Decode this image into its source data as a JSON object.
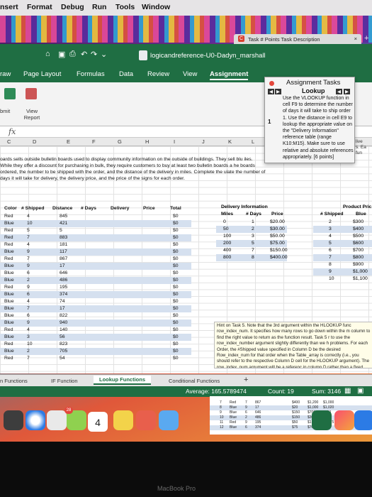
{
  "menubar": {
    "items": [
      "nsert",
      "Format",
      "Debug",
      "Run",
      "Tools",
      "Window"
    ]
  },
  "browser_tab": {
    "title": "Task # Points Task Description",
    "close": "×",
    "new_tab": "+"
  },
  "window": {
    "filename": "logicandreference-U0-Dadyn_marshall"
  },
  "ribbon_tabs": [
    "raw",
    "Page Layout",
    "Formulas",
    "Data",
    "Review",
    "View",
    "Assignment"
  ],
  "ribbon": {
    "submit_label": "bmit",
    "view_report_label": "View Report",
    "fx": "fx"
  },
  "column_headers": [
    "C",
    "D",
    "E",
    "F",
    "G",
    "H",
    "I",
    "J",
    "K",
    "L"
  ],
  "description": "oards sells outside bulletin boards used to display community information on the outside of buildings. They sell blu iles. While they offer a discount for purchasing in bulk, they require customers to buy at least two bulletin boards a he boards ordered, the number to be shipped with the order, and the distance of the delivery in miles. Complete the ulate the number of days it will take for delivery, the delivery price, and the price of the signs for each order.",
  "orders": {
    "headers": [
      "Color",
      "# Shipped",
      "Distance",
      "# Days",
      "Delivery",
      "Price",
      "Total"
    ],
    "rows": [
      [
        "Red",
        "4",
        "845",
        "$0"
      ],
      [
        "Blue",
        "10",
        "421",
        "$0"
      ],
      [
        "Red",
        "5",
        "5",
        "$0"
      ],
      [
        "Red",
        "7",
        "883",
        "$0"
      ],
      [
        "Red",
        "4",
        "181",
        "$0"
      ],
      [
        "Blue",
        "9",
        "117",
        "$0"
      ],
      [
        "Red",
        "7",
        "867",
        "$0"
      ],
      [
        "Blue",
        "9",
        "17",
        "$0"
      ],
      [
        "Blue",
        "6",
        "646",
        "$0"
      ],
      [
        "Blue",
        "2",
        "486",
        "$0"
      ],
      [
        "Red",
        "9",
        "195",
        "$0"
      ],
      [
        "Blue",
        "6",
        "374",
        "$0"
      ],
      [
        "Blue",
        "4",
        "74",
        "$0"
      ],
      [
        "Blue",
        "7",
        "17",
        "$0"
      ],
      [
        "Blue",
        "6",
        "822",
        "$0"
      ],
      [
        "Blue",
        "9",
        "940",
        "$0"
      ],
      [
        "Red",
        "4",
        "140",
        "$0"
      ],
      [
        "Blue",
        "3",
        "56",
        "$0"
      ],
      [
        "Red",
        "10",
        "823",
        "$0"
      ],
      [
        "Blue",
        "2",
        "705",
        "$0"
      ],
      [
        "Red",
        "7",
        "54",
        "$0"
      ]
    ]
  },
  "delivery": {
    "title": "Delivery Information",
    "headers": [
      "Miles",
      "# Days",
      "Price"
    ],
    "rows": [
      [
        "0",
        "1",
        "$20.00"
      ],
      [
        "50",
        "2",
        "$30.00"
      ],
      [
        "100",
        "3",
        "$50.00"
      ],
      [
        "200",
        "5",
        "$75.00"
      ],
      [
        "400",
        "7",
        "$150.00"
      ],
      [
        "800",
        "8",
        "$400.00"
      ]
    ]
  },
  "product": {
    "title": "Product Pric",
    "headers": [
      "# Shipped",
      "Blue"
    ],
    "rows": [
      [
        "2",
        "$300"
      ],
      [
        "3",
        "$400"
      ],
      [
        "4",
        "$500"
      ],
      [
        "5",
        "$600"
      ],
      [
        "6",
        "$700"
      ],
      [
        "7",
        "$800"
      ],
      [
        "8",
        "$900"
      ],
      [
        "9",
        "$1,000"
      ],
      [
        "10",
        "$1,100"
      ]
    ]
  },
  "hint": "Hint on Task 5. Note that the 3rd argument within the HLOOKUP func row_index_num. It specifies how many rows to go down within the m column to find the right value to return as the function result. Task 5 r to use the row_index_number argument slightly differently than we h problems. For each Order, the #Shipped value specified in Column D be the desired Row_index_num for that order when the Table_array is correctly (i.e., you should refer to the respective Column D cell for the HLOOKUP argument). The row_index_num argument will be a referenc in column D rather than a fixed number.",
  "tasks_panel": {
    "title": "Assignment Tasks",
    "nav_left": "◀",
    "nav_right": "▶",
    "topic": "Lookup",
    "number": "1",
    "body": "Use the VLOOKUP function in cell F9 to determine the number of days it will take to ship order 1. Use the distance in cell E9 to lookup the appropriate value on the \"Delivery Information\" reference table (range K10:M15). Make sure to use relative and absolute references appropriately. [6 points]"
  },
  "side_clip": [
    "live",
    "s. Ea",
    "fun"
  ],
  "sheet_tabs": [
    "n Functions",
    "IF Function",
    "Lookup Functions",
    "Conditional Functions",
    "+"
  ],
  "status": {
    "average": "Average: 165.5789474",
    "count": "Count: 19",
    "sum": "Sum: 3146"
  },
  "mini_sheet": {
    "rows": [
      [
        "7",
        "Red",
        "7",
        "867",
        "$400",
        "$1,200",
        "$1,000"
      ],
      [
        "8",
        "Blue",
        "9",
        "17",
        "$20",
        "$1,000",
        "$1,020"
      ],
      [
        "9",
        "Blue",
        "6",
        "646",
        "$150",
        "$700",
        "$850"
      ],
      [
        "10",
        "Blue",
        "2",
        "486",
        "$150",
        "$300",
        "$450"
      ],
      [
        "11",
        "Red",
        "9",
        "195",
        "$50",
        "$1,425",
        "$1,475"
      ],
      [
        "12",
        "Blue",
        "6",
        "374",
        "$75",
        "$700",
        "$775"
      ]
    ]
  },
  "dock": {
    "calendar_day": "4",
    "badge": "28"
  },
  "bezel_label": "MacBook Pro",
  "colors": {
    "excel_green": "#1f6e43",
    "hint_bg": "#fffde8",
    "shade": "#d5e0ef"
  }
}
